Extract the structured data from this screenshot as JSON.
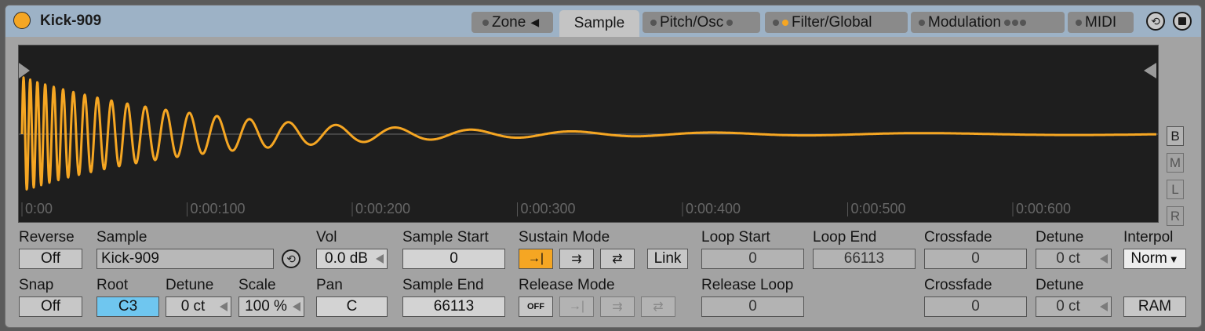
{
  "device": {
    "title": "Kick-909",
    "power_on": true
  },
  "tabs": [
    {
      "label": "Zone",
      "arrow": "◀"
    },
    {
      "label": "Sample"
    },
    {
      "label": "Pitch/Osc"
    },
    {
      "label": "Filter/Global"
    },
    {
      "label": "Modulation"
    },
    {
      "label": "MIDI"
    }
  ],
  "waveform": {
    "color": "#f5a623",
    "time_ticks": [
      "0:00",
      "0:00:100",
      "0:00:200",
      "0:00:300",
      "0:00:400",
      "0:00:500",
      "0:00:600"
    ]
  },
  "side_buttons": [
    "B",
    "M",
    "L",
    "R"
  ],
  "controls": {
    "reverse": {
      "label": "Reverse",
      "value": "Off"
    },
    "snap": {
      "label": "Snap",
      "value": "Off"
    },
    "sample": {
      "label": "Sample",
      "value": "Kick-909"
    },
    "root": {
      "label": "Root",
      "value": "C3"
    },
    "detune_root": {
      "label": "Detune",
      "value": "0 ct"
    },
    "scale": {
      "label": "Scale",
      "value": "100 %"
    },
    "vol": {
      "label": "Vol",
      "value": "0.0 dB"
    },
    "pan": {
      "label": "Pan",
      "value": "C"
    },
    "sample_start": {
      "label": "Sample Start",
      "value": "0"
    },
    "sample_end": {
      "label": "Sample End",
      "value": "66113"
    },
    "sustain_mode": {
      "label": "Sustain Mode",
      "link_label": "Link"
    },
    "release_mode": {
      "label": "Release Mode",
      "off_label": "OFF"
    },
    "loop_start": {
      "label": "Loop Start",
      "value": "0"
    },
    "loop_end": {
      "label": "Loop End",
      "value": "66113"
    },
    "release_loop": {
      "label": "Release Loop",
      "value": "0"
    },
    "crossfade_1": {
      "label": "Crossfade",
      "value": "0"
    },
    "crossfade_2": {
      "label": "Crossfade",
      "value": "0"
    },
    "detune_1": {
      "label": "Detune",
      "value": "0 ct"
    },
    "detune_2": {
      "label": "Detune",
      "value": "0 ct"
    },
    "interpol": {
      "label": "Interpol",
      "value": "Norm"
    },
    "ram": {
      "label": "RAM"
    }
  }
}
